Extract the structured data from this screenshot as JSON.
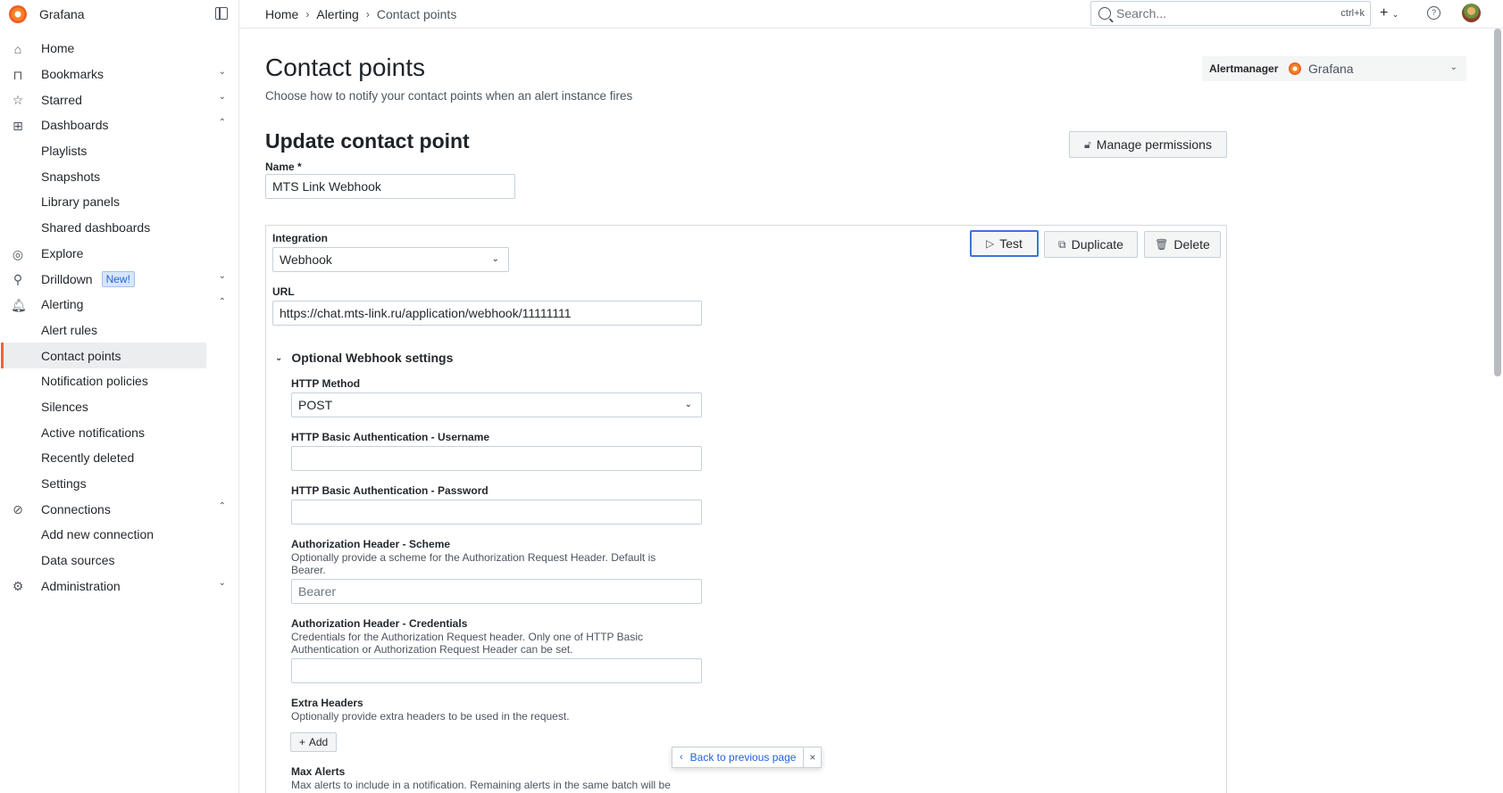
{
  "brand": {
    "name": "Grafana"
  },
  "topbar": {
    "breadcrumbs": [
      "Home",
      "Alerting",
      "Contact points"
    ],
    "search_placeholder": "Search...",
    "search_shortcut": "ctrl+k",
    "plus_label": "+",
    "help_label": "?"
  },
  "sidebar": {
    "items": [
      {
        "label": "Home",
        "icon": "home-icon",
        "level": 0
      },
      {
        "label": "Bookmarks",
        "icon": "bookmark-icon",
        "level": 0,
        "chevron": "down"
      },
      {
        "label": "Starred",
        "icon": "star-icon",
        "level": 0,
        "chevron": "down"
      },
      {
        "label": "Dashboards",
        "icon": "apps-icon",
        "level": 0,
        "chevron": "up"
      },
      {
        "label": "Playlists",
        "level": 1
      },
      {
        "label": "Snapshots",
        "level": 1
      },
      {
        "label": "Library panels",
        "level": 1
      },
      {
        "label": "Shared dashboards",
        "level": 1
      },
      {
        "label": "Explore",
        "icon": "compass-icon",
        "level": 0
      },
      {
        "label": "Drilldown",
        "icon": "drilldown-icon",
        "level": 0,
        "chevron": "down",
        "badge": "New!"
      },
      {
        "label": "Alerting",
        "icon": "bell-icon",
        "level": 0,
        "chevron": "up"
      },
      {
        "label": "Alert rules",
        "level": 1
      },
      {
        "label": "Contact points",
        "level": 1,
        "active": true
      },
      {
        "label": "Notification policies",
        "level": 1
      },
      {
        "label": "Silences",
        "level": 1
      },
      {
        "label": "Active notifications",
        "level": 1
      },
      {
        "label": "Recently deleted",
        "level": 1
      },
      {
        "label": "Settings",
        "level": 1
      },
      {
        "label": "Connections",
        "icon": "connections-icon",
        "level": 0,
        "chevron": "up"
      },
      {
        "label": "Add new connection",
        "level": 1
      },
      {
        "label": "Data sources",
        "level": 1
      },
      {
        "label": "Administration",
        "icon": "cog-icon",
        "level": 0,
        "chevron": "down"
      }
    ]
  },
  "page": {
    "title": "Contact points",
    "description": "Choose how to notify your contact points when an alert instance fires",
    "alertmanager_label": "Alertmanager",
    "alertmanager_value": "Grafana",
    "section_title": "Update contact point",
    "manage_permissions": "Manage permissions"
  },
  "form": {
    "name_label": "Name *",
    "name_value": "MTS Link Webhook",
    "integration_label": "Integration",
    "integration_value": "Webhook",
    "test_label": "Test",
    "duplicate_label": "Duplicate",
    "delete_label": "Delete",
    "url_label": "URL",
    "url_value": "https://chat.mts-link.ru/application/webhook/11111111",
    "optional_title": "Optional Webhook settings",
    "http_method_label": "HTTP Method",
    "http_method_value": "POST",
    "basic_user_label": "HTTP Basic Authentication - Username",
    "basic_user_value": "",
    "basic_pass_label": "HTTP Basic Authentication - Password",
    "basic_pass_value": "",
    "auth_scheme_label": "Authorization Header - Scheme",
    "auth_scheme_desc": "Optionally provide a scheme for the Authorization Request Header. Default is Bearer.",
    "auth_scheme_placeholder": "Bearer",
    "auth_cred_label": "Authorization Header - Credentials",
    "auth_cred_desc": "Credentials for the Authorization Request header. Only one of HTTP Basic Authentication or Authorization Request Header can be set.",
    "auth_cred_value": "",
    "extra_headers_label": "Extra Headers",
    "extra_headers_desc": "Optionally provide extra headers to be used in the request.",
    "add_label": "Add",
    "max_alerts_label": "Max Alerts",
    "max_alerts_desc": "Max alerts to include in a notification. Remaining alerts in the same batch will be"
  },
  "footer": {
    "back_label": "Back to previous page",
    "close_label": "×"
  },
  "colors": {
    "accent": "#3d71d9",
    "active_marker": "#f55f3e",
    "new_badge": "#d8e6fb"
  }
}
